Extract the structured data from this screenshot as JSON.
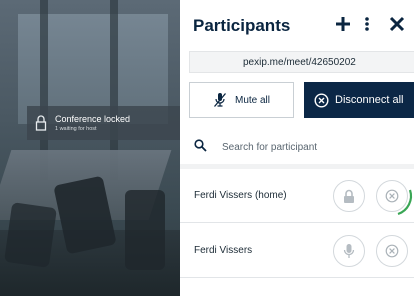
{
  "video": {
    "banner_title": "Conference locked",
    "banner_subtitle": "1 waiting for host"
  },
  "panel": {
    "title": "Participants",
    "header_icons": [
      "plus-icon",
      "more-vertical-icon",
      "close-icon"
    ],
    "meeting_url": "pexip.me/meet/42650202",
    "mute_all_label": "Mute all",
    "disconnect_all_label": "Disconnect all",
    "search_placeholder": "Search for participant"
  },
  "participants": [
    {
      "name": "Ferdi Vissers (home)",
      "action_icon": "lock-icon"
    },
    {
      "name": "Ferdi Vissers",
      "action_icon": "microphone-icon"
    }
  ],
  "colors": {
    "navy": "#0b2746",
    "accent_green": "#3aa655"
  }
}
